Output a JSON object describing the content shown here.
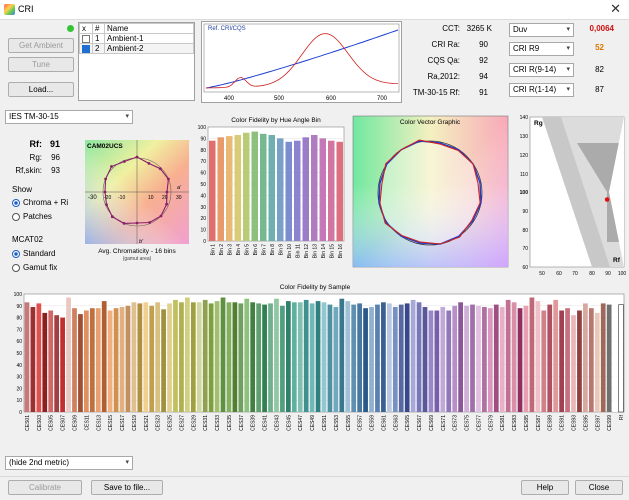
{
  "window": {
    "title": "CRI"
  },
  "left_buttons": {
    "get_ambient": "Get Ambient",
    "tune": "Tune",
    "load": "Load..."
  },
  "list": {
    "headers": [
      "x",
      "#",
      "Name"
    ],
    "rows": [
      {
        "checked": false,
        "num": "1",
        "name": "Ambient-1"
      },
      {
        "checked": true,
        "num": "2",
        "name": "Ambient-2"
      }
    ]
  },
  "spectrum_chart": {
    "title": "Ref. CRI/CQS",
    "x_ticks": [
      "400",
      "500",
      "600",
      "700"
    ]
  },
  "metrics": [
    {
      "label": "CCT:",
      "value": "3265 K"
    },
    {
      "label": "CRI Ra:",
      "value": "90"
    },
    {
      "label": "CQS Qa:",
      "value": "92"
    },
    {
      "label": "Ra,2012:",
      "value": "94"
    },
    {
      "label": "TM-30-15 Rf:",
      "value": "91"
    }
  ],
  "right_metrics": [
    {
      "select": "Duv",
      "value": "0,0064",
      "color": "#d01010"
    },
    {
      "select": "CRI R9",
      "value": "52",
      "color": "#e07800"
    },
    {
      "select": "CRI R(9-14)",
      "value": "82",
      "color": "#000000"
    },
    {
      "select": "CRI R(1-14)",
      "value": "87",
      "color": "#000000"
    }
  ],
  "method_select": "IES TM-30-15",
  "tm30": {
    "rf_label": "Rf:",
    "rf": "91",
    "rg_label": "Rg:",
    "rg": "96",
    "rfskin_label": "Rf,skin:",
    "rfskin": "93"
  },
  "show_group": {
    "title": "Show",
    "options": [
      "Chroma + Ri",
      "Patches"
    ],
    "selected": 0
  },
  "mcat_group": {
    "title": "MCAT02",
    "options": [
      "Standard",
      "Gamut fix"
    ],
    "selected": 0
  },
  "gamut_chart": {
    "title": "CAM02UCS",
    "caption": "Avg. Chromaticity - 16 bins",
    "subcaption": "(gamut area)",
    "da_label": "a'",
    "db_label": "b'",
    "axis_ticks": [
      "-30",
      "-20",
      "-10",
      "10",
      "20",
      "30"
    ]
  },
  "hue_bins_chart": {
    "title": "Color Fidelity by Hue Angle Bin",
    "y_ticks": [
      "100",
      "90",
      "80",
      "70",
      "60",
      "50",
      "40",
      "30",
      "20",
      "10",
      "0"
    ],
    "categories": [
      "Bin 1",
      "Bin 2",
      "Bin 3",
      "Bin 4",
      "Bin 5",
      "Bin 6",
      "Bin 7",
      "Bin 8",
      "Bin 9",
      "Bin 10",
      "Bin 11",
      "Bin 12",
      "Bin 13",
      "Bin 14",
      "Bin 15",
      "Bin 16"
    ],
    "values": [
      88,
      91,
      92,
      93,
      95,
      96,
      94,
      93,
      90,
      87,
      88,
      91,
      93,
      90,
      88,
      87
    ],
    "colors": [
      "#e06e6e",
      "#e89a6a",
      "#e8b874",
      "#d8cc78",
      "#b8cc78",
      "#8cc07c",
      "#76b890",
      "#6eb0b0",
      "#78a0c8",
      "#7c8cd0",
      "#8c84d0",
      "#9c7cc8",
      "#b07cc0",
      "#c478b8",
      "#d474a0",
      "#dc7080"
    ]
  },
  "vector_chart": {
    "title": "Color Vector Graphic"
  },
  "rfrg_chart": {
    "y_label": "Rg",
    "x_label": "Rf",
    "y_ticks": [
      "140",
      "130",
      "120",
      "110",
      "100",
      "90",
      "80",
      "70",
      "60"
    ],
    "x_ticks": [
      "50",
      "60",
      "70",
      "80",
      "90",
      "100"
    ],
    "point": {
      "rf": 91,
      "rg": 96
    }
  },
  "sample_chart": {
    "title": "Color Fidelity by Sample",
    "y_ticks": [
      "100",
      "90",
      "80",
      "70",
      "60",
      "50",
      "40",
      "30",
      "20",
      "10",
      "0"
    ],
    "labels": [
      "CES01",
      "CES03",
      "CES05",
      "CES07",
      "CES09",
      "CES11",
      "CES13",
      "CES15",
      "CES17",
      "CES19",
      "CES21",
      "CES23",
      "CES25",
      "CES27",
      "CES29",
      "CES31",
      "CES33",
      "CES35",
      "CES37",
      "CES39",
      "CES41",
      "CES43",
      "CES45",
      "CES47",
      "CES49",
      "CES51",
      "CES53",
      "CES55",
      "CES57",
      "CES59",
      "CES61",
      "CES63",
      "CES65",
      "CES67",
      "CES69",
      "CES71",
      "CES73",
      "CES75",
      "CES77",
      "CES79",
      "CES81",
      "CES83",
      "CES85",
      "CES87",
      "CES89",
      "CES91",
      "CES93",
      "CES95",
      "CES97",
      "CES99",
      "Rf"
    ],
    "values": [
      93,
      89,
      92,
      84,
      86,
      82,
      80,
      97,
      88,
      83,
      86,
      88,
      88,
      94,
      86,
      88,
      89,
      90,
      93,
      92,
      93,
      90,
      93,
      87,
      92,
      95,
      93,
      97,
      93,
      93,
      95,
      92,
      94,
      97,
      93,
      93,
      92,
      96,
      93,
      92,
      91,
      92,
      96,
      90,
      94,
      93,
      93,
      95,
      92,
      94,
      93,
      91,
      89,
      96,
      94,
      91,
      92,
      88,
      89,
      91,
      93,
      92,
      89,
      91,
      92,
      95,
      93,
      89,
      86,
      86,
      89,
      86,
      90,
      93,
      90,
      91,
      90,
      89,
      88,
      91,
      89,
      95,
      93,
      88,
      90,
      97,
      94,
      86,
      91,
      95,
      86,
      88,
      82,
      86,
      92,
      88,
      84,
      92,
      91,
      91
    ],
    "colors": [
      "#c87878",
      "#9a3030",
      "#e05050",
      "#8a2020",
      "#d06868",
      "#a04040",
      "#c03030",
      "#e8c8c0",
      "#d08060",
      "#a05030",
      "#e09060",
      "#c07040",
      "#e8a070",
      "#b06030",
      "#f0b080",
      "#d09050",
      "#e0b080",
      "#c09060",
      "#e0c090",
      "#b09040",
      "#f0d090",
      "#c0a050",
      "#d8c080",
      "#a09040",
      "#e0d090",
      "#c0c060",
      "#b0b050",
      "#d0d080",
      "#a0a040",
      "#d0d8a0",
      "#90a050",
      "#80a040",
      "#a0c070",
      "#609040",
      "#80b060",
      "#508030",
      "#70a060",
      "#90c080",
      "#408040",
      "#60a070",
      "#308050",
      "#70b090",
      "#90c8a0",
      "#50a080",
      "#30806a",
      "#60b0a0",
      "#80c0b0",
      "#409090",
      "#70b8b8",
      "#308080",
      "#90c8d0",
      "#5090a0",
      "#70a8c0",
      "#3a7890",
      "#a0c0d8",
      "#6090b0",
      "#4878a0",
      "#2a5888",
      "#90b0d0",
      "#5a80b0",
      "#3a6090",
      "#b8c8e0",
      "#7890c0",
      "#5868a0",
      "#384888",
      "#a8a8d8",
      "#7878b8",
      "#585898",
      "#9888c8",
      "#7860a8",
      "#c0a8d8",
      "#9078b8",
      "#b890c8",
      "#8a5898",
      "#d0b0d8",
      "#a070a8",
      "#e0c0e0",
      "#b070a0",
      "#d898c0",
      "#a05080",
      "#e8b0c8",
      "#c07090",
      "#d890a8",
      "#903060",
      "#e8a0b0",
      "#c06878",
      "#f0c0c8",
      "#d08088",
      "#b05060",
      "#e09898",
      "#a04050",
      "#c87080",
      "#e8b8b8",
      "#904040",
      "#d8a8a0",
      "#b87870",
      "#e8c8b8",
      "#a06858",
      "#707070",
      "#ffffff"
    ],
    "rf_bar_value": 91
  },
  "second_metric_select": "(hide 2nd metric)",
  "footer_buttons": {
    "calibrate": "Calibrate",
    "save": "Save to file...",
    "help": "Help",
    "close": "Close"
  }
}
